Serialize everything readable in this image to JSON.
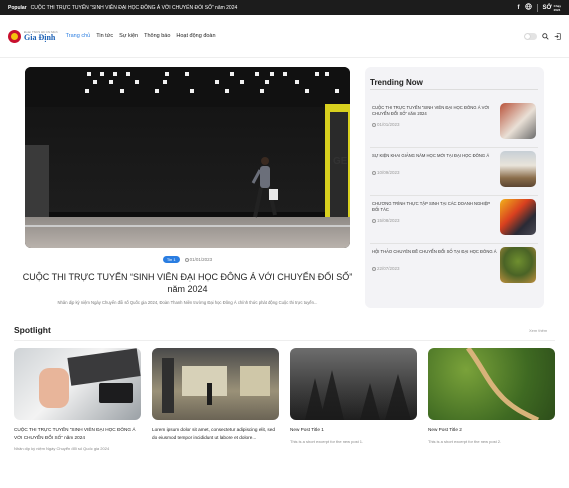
{
  "topbar": {
    "popular_label": "Popular",
    "headline": "CUỘC THI TRỰC TUYẾN “SINH VIÊN ĐẠI HỌC ĐÔNG Á VỚI CHUYỂN ĐỔI SỐ” năm 2024",
    "right_logo_top": "SỞ",
    "right_logo_mid": "Chạy",
    "right_logo_bot": "2024"
  },
  "brand": {
    "small": "Đoàn TNCS Hồ Chí Minh",
    "name": "Gia Định"
  },
  "nav": {
    "items": [
      "Trang chủ",
      "Tin tức",
      "Sự kiện",
      "Thông báo",
      "Hoạt động đoàn"
    ]
  },
  "hero": {
    "tag": "Tin 1",
    "date": "01/01/2023",
    "title": "CUỘC THI TRỰC TUYẾN “SINH VIÊN ĐẠI HỌC ĐÔNG Á VỚI CHUYỂN ĐỔI SỐ” năm 2024",
    "excerpt": "Nhân dịp kỷ niệm Ngày Chuyển đổi số Quốc gia 2024, Đoàn Thanh Niên trường Đại học Đông Á chính thức phát động Cuộc thi trực tuyến..."
  },
  "trending": {
    "heading": "Trending Now",
    "items": [
      {
        "title": "CUỘC THI TRỰC TUYẾN “SINH VIÊN ĐẠI HỌC ĐÔNG Á VỚI CHUYỂN ĐỔI SỐ” năm 2024",
        "date": "01/01/2023"
      },
      {
        "title": "SỰ KIỆN KHAI GIẢNG NĂM HỌC MỚI TẠI ĐẠI HỌC ĐÔNG Á",
        "date": "10/09/2023"
      },
      {
        "title": "CHƯƠNG TRÌNH THỰC TẬP SINH TẠI CÁC DOANH NGHIỆP ĐỐI TÁC",
        "date": "15/08/2023"
      },
      {
        "title": "HỘI THẢO CHUYÊN ĐỀ CHUYỂN ĐỔI SỐ TẠI ĐẠI HỌC ĐÔNG Á",
        "date": "22/07/2023"
      }
    ]
  },
  "spotlight": {
    "heading": "Spotlight",
    "more": "Xem thêm",
    "cards": [
      {
        "title": "CUỘC THI TRỰC TUYẾN “SINH VIÊN ĐẠI HỌC ĐÔNG Á VỚI CHUYỂN ĐỔI SỐ” năm 2024",
        "excerpt": "Nhân dịp kỷ niệm Ngày Chuyển đổi số Quốc gia 2024"
      },
      {
        "title": "Lorem ipsum dolor sit amet, consectetur adipiscing elit, sed do eiusmod tempor incididunt ut labore et dolore...",
        "excerpt": ""
      },
      {
        "title": "New Post Title 1",
        "excerpt": "This is a short excerpt for the new post 1."
      },
      {
        "title": "New Post Title 2",
        "excerpt": "This is a short excerpt for the new post 2."
      }
    ]
  },
  "colors": {
    "accent": "#2a7de1",
    "topbar": "#1c1c1c"
  }
}
